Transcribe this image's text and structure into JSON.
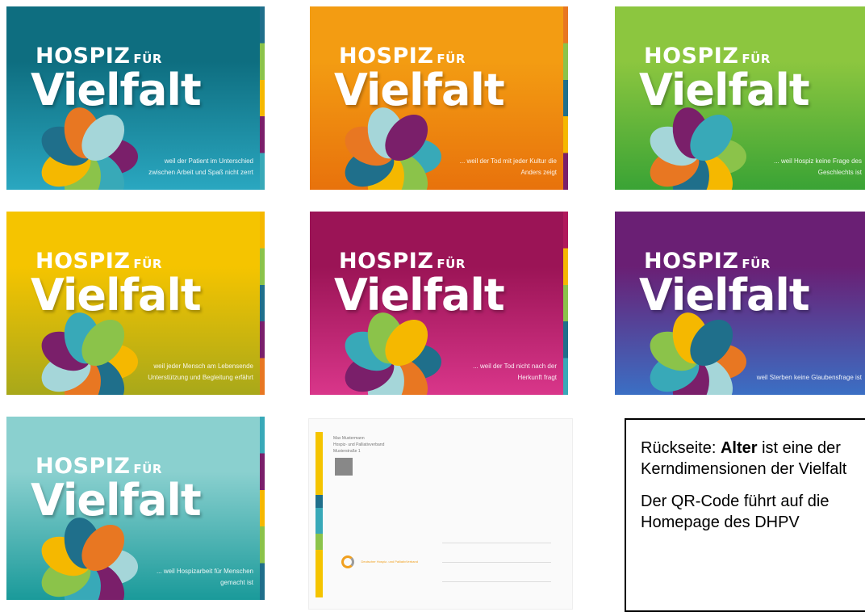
{
  "cards": [
    {
      "hospiz": "HOSPIZ",
      "fur": "FÜR",
      "vielfalt": "Vielfalt",
      "bg": [
        "#0e6e80",
        "#2aa7c0"
      ],
      "stripe": [
        "#1f6f8b",
        "#8bc34a",
        "#f5b800",
        "#7a1f6a",
        "#38a9b8"
      ],
      "caption": "weil der Patient im Unterschied zwischen Arbeit und Spaß nicht zerrt"
    },
    {
      "hospiz": "HOSPIZ",
      "fur": "FÜR",
      "vielfalt": "Vielfalt",
      "bg": [
        "#f39c12",
        "#e8720c"
      ],
      "stripe": [
        "#e87722",
        "#8bc34a",
        "#1f6f8b",
        "#f5b800",
        "#7a1f6a"
      ],
      "caption": "... weil der Tod mit jeder Kultur die Anders zeigt"
    },
    {
      "hospiz": "HOSPIZ",
      "fur": "FÜR",
      "vielfalt": "Vielfalt",
      "bg": [
        "#8cc63f",
        "#3aa335"
      ],
      "stripe": [
        "#6ab04c",
        "#f5b800",
        "#7a1f6a",
        "#1f6f8b",
        "#38a9b8"
      ],
      "caption": "... weil Hospiz keine Frage des Geschlechts ist"
    },
    {
      "hospiz": "HOSPIZ",
      "fur": "FÜR",
      "vielfalt": "Vielfalt",
      "bg": [
        "#f5c400",
        "#a8a81a"
      ],
      "stripe": [
        "#f5b800",
        "#8bc34a",
        "#1f6f8b",
        "#7a1f6a",
        "#e87722"
      ],
      "caption": "weil jeder Mensch am Lebensende Unterstützung und Begleitung erfährt"
    },
    {
      "hospiz": "HOSPIZ",
      "fur": "FÜR",
      "vielfalt": "Vielfalt",
      "bg": [
        "#9b1456",
        "#d9368a"
      ],
      "stripe": [
        "#b0185c",
        "#f5b800",
        "#8bc34a",
        "#1f6f8b",
        "#38a9b8"
      ],
      "caption": "... weil der Tod nicht nach der Herkunft fragt"
    },
    {
      "hospiz": "HOSPIZ",
      "fur": "FÜR",
      "vielfalt": "Vielfalt",
      "bg": [
        "#6a1f74",
        "#3b6fc4"
      ],
      "stripe": [
        "#6a1f74",
        "#8bc34a",
        "#f5b800",
        "#1f6f8b",
        "#38a9b8"
      ],
      "caption": "weil Sterben keine Glaubensfrage ist"
    },
    {
      "hospiz": "HOSPIZ",
      "fur": "FÜR",
      "vielfalt": "Vielfalt",
      "bg": [
        "#8ad0cf",
        "#1a9a9a"
      ],
      "stripe": [
        "#38a9b8",
        "#7a1f6a",
        "#f5b800",
        "#8bc34a",
        "#1f6f8b"
      ],
      "caption": "... weil Hospizarbeit für Menschen gemacht ist"
    }
  ],
  "backcard": {
    "addr": [
      "Max Mustermann",
      "Hospiz- und Palliativverband",
      "Musterstraße 1"
    ],
    "bar": [
      "#f5c400",
      "#1f6f8b",
      "#38a9b8",
      "#8bc34a",
      "#f5c400"
    ],
    "logo_text": "Deutscher Hospiz- und PalliativVerband"
  },
  "textbox": {
    "para1_prefix": "Rückseite: ",
    "para1_bold": "Alter",
    "para1_suffix": " ist eine der Kerndimensionen der Vielfalt",
    "para2": "Der QR-Code führt auf die Homepage des DHPV"
  }
}
